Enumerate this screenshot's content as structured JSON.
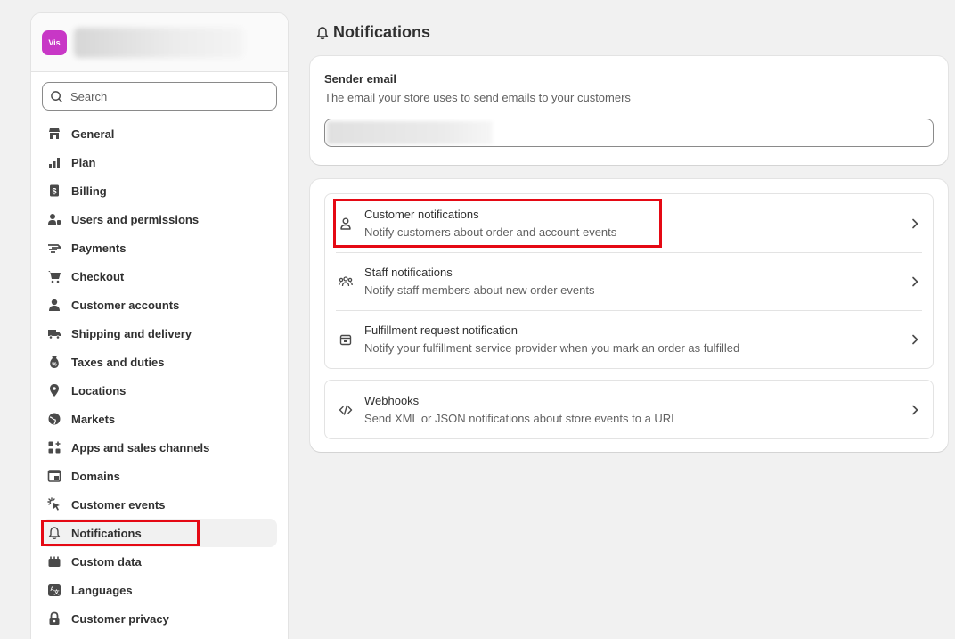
{
  "store": {
    "avatar_text": "Vis"
  },
  "search": {
    "placeholder": "Search"
  },
  "sidebar": {
    "items": [
      {
        "label": "General",
        "icon": "store-icon"
      },
      {
        "label": "Plan",
        "icon": "plan-icon"
      },
      {
        "label": "Billing",
        "icon": "billing-icon"
      },
      {
        "label": "Users and permissions",
        "icon": "users-icon"
      },
      {
        "label": "Payments",
        "icon": "payments-icon"
      },
      {
        "label": "Checkout",
        "icon": "cart-icon"
      },
      {
        "label": "Customer accounts",
        "icon": "person-icon"
      },
      {
        "label": "Shipping and delivery",
        "icon": "truck-icon"
      },
      {
        "label": "Taxes and duties",
        "icon": "tax-icon"
      },
      {
        "label": "Locations",
        "icon": "location-pin-icon"
      },
      {
        "label": "Markets",
        "icon": "globe-icon"
      },
      {
        "label": "Apps and sales channels",
        "icon": "apps-icon"
      },
      {
        "label": "Domains",
        "icon": "domain-icon"
      },
      {
        "label": "Customer events",
        "icon": "cursor-click-icon"
      },
      {
        "label": "Notifications",
        "icon": "bell-icon",
        "active": true
      },
      {
        "label": "Custom data",
        "icon": "custom-data-icon"
      },
      {
        "label": "Languages",
        "icon": "translate-icon"
      },
      {
        "label": "Customer privacy",
        "icon": "lock-icon"
      }
    ]
  },
  "page": {
    "title": "Notifications"
  },
  "sender": {
    "label": "Sender email",
    "description": "The email your store uses to send emails to your customers"
  },
  "notifications": {
    "rows": [
      {
        "title": "Customer notifications",
        "description": "Notify customers about order and account events",
        "icon": "person-outline-icon"
      },
      {
        "title": "Staff notifications",
        "description": "Notify staff members about new order events",
        "icon": "team-icon"
      },
      {
        "title": "Fulfillment request notification",
        "description": "Notify your fulfillment service provider when you mark an order as fulfilled",
        "icon": "package-icon"
      }
    ],
    "webhooks": {
      "title": "Webhooks",
      "description": "Send XML or JSON notifications about store events to a URL",
      "icon": "code-icon"
    }
  },
  "colors": {
    "highlight": "#e50914",
    "store_avatar": "#c837c6",
    "background": "#f1f1f1"
  }
}
